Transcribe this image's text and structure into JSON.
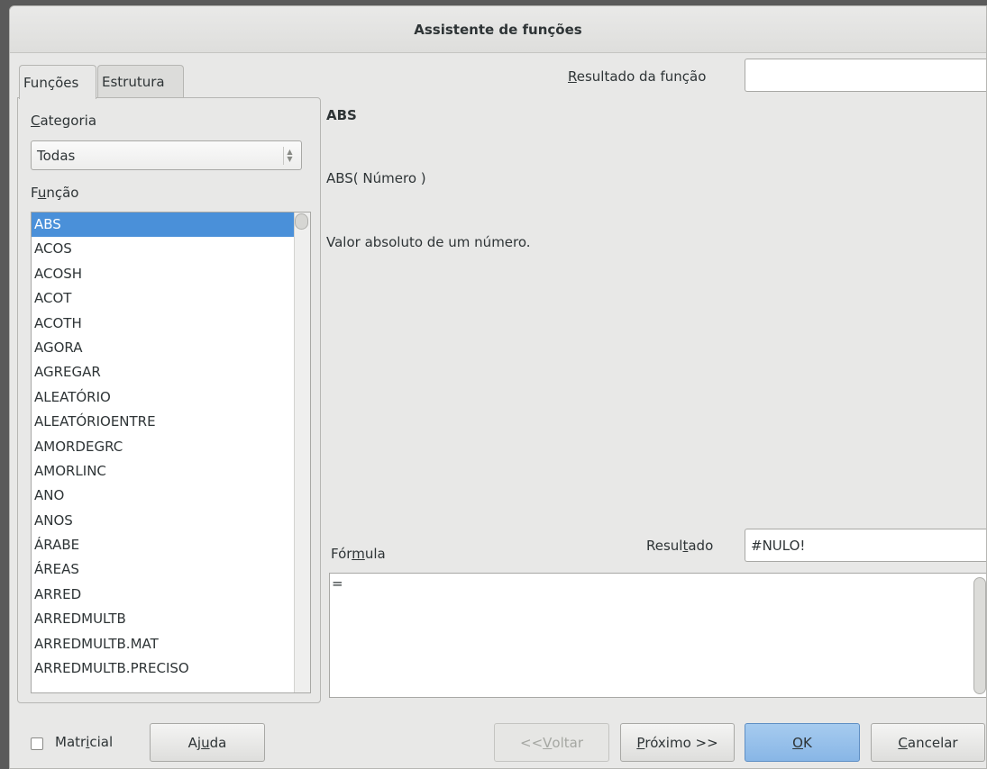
{
  "window": {
    "title": "Assistente de funções"
  },
  "tabs": [
    {
      "label": "Funções",
      "active": true
    },
    {
      "label": "Estrutura",
      "active": false
    }
  ],
  "left": {
    "category_label_pre": "",
    "category_label_u": "C",
    "category_label_post": "ategoria",
    "category_value": "Todas",
    "function_label_pre": "F",
    "function_label_u": "u",
    "function_label_post": "nção",
    "functions": [
      "ABS",
      "ACOS",
      "ACOSH",
      "ACOT",
      "ACOTH",
      "AGORA",
      "AGREGAR",
      "ALEATÓRIO",
      "ALEATÓRIOENTRE",
      "AMORDEGRC",
      "AMORLINC",
      "ANO",
      "ANOS",
      "ÁRABE",
      "ÁREAS",
      "ARRED",
      "ARREDMULTB",
      "ARREDMULTB.MAT",
      "ARREDMULTB.PRECISO"
    ],
    "selected_function": "ABS"
  },
  "right": {
    "function_result_label_u": "R",
    "function_result_label_post": "esultado da função",
    "function_result_value": "",
    "function_name": "ABS",
    "function_signature": "ABS( Número )",
    "function_description": "Valor absoluto de um número.",
    "formula_label_pre": "Fór",
    "formula_label_u": "m",
    "formula_label_post": "ula",
    "result_label_pre": "Resul",
    "result_label_u": "t",
    "result_label_post": "ado",
    "result_value": "#NULO!",
    "formula_text": "="
  },
  "footer": {
    "matrix_pre": "Matr",
    "matrix_u": "i",
    "matrix_post": "cial",
    "matrix_checked": false,
    "help_pre": "Aj",
    "help_u": "u",
    "help_post": "da",
    "back_pre": "<<",
    "back_u": "V",
    "back_post": "oltar",
    "next_u": "P",
    "next_post": "róximo >>",
    "ok_u": "O",
    "ok_post": "K",
    "cancel_u": "C",
    "cancel_post": "ancelar"
  },
  "colors": {
    "selection": "#4a90d9",
    "default_button": "#88b6e6"
  }
}
